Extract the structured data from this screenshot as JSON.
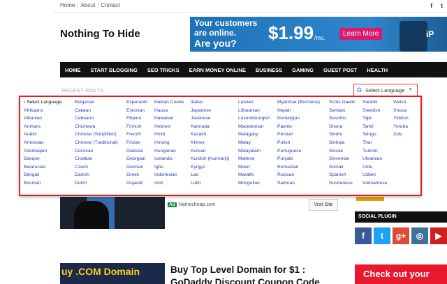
{
  "topbar": {
    "links": [
      "Home",
      "About",
      "Contact"
    ],
    "social": [
      "f",
      "t"
    ]
  },
  "site": {
    "title": "Nothing To Hide"
  },
  "banner_ad": {
    "line1": "Your customers",
    "line2": "are online.",
    "line3": "Are you?",
    "price": "$1.99",
    "per": "/mo.",
    "cta": "Learn More",
    "brand": "iP"
  },
  "nav": {
    "items": [
      "HOME",
      "START BLOGGING",
      "SEO TRICKS",
      "EARN MONEY ONLINE",
      "BUSINESS",
      "GAMING",
      "GUEST POST",
      "HEALTH"
    ]
  },
  "main": {
    "recent_posts_label": "RECENT POSTS"
  },
  "translate": {
    "g_logo": "G",
    "label": "Select Language",
    "arrow": "▼",
    "columns": [
      [
        "Select Language",
        "Afrikaans",
        "Albanian",
        "Amharic",
        "Arabic",
        "Armenian",
        "Azerbaijani",
        "Basque",
        "Belarusian",
        "Bengali",
        "Bosnian"
      ],
      [
        "Bulgarian",
        "Catalan",
        "Cebuano",
        "Chichewa",
        "Chinese (Simplified)",
        "Chinese (Traditional)",
        "Corsican",
        "Croatian",
        "Czech",
        "Danish",
        "Dutch"
      ],
      [
        "Esperanto",
        "Estonian",
        "Filipino",
        "Finnish",
        "French",
        "Frisian",
        "Galician",
        "Georgian",
        "German",
        "Greek",
        "Gujarati"
      ],
      [
        "Haitian Creole",
        "Hausa",
        "Hawaiian",
        "Hebrew",
        "Hindi",
        "Hmong",
        "Hungarian",
        "Icelandic",
        "Igbo",
        "Indonesian",
        "Irish"
      ],
      [
        "Italian",
        "Japanese",
        "Javanese",
        "Kannada",
        "Kazakh",
        "Khmer",
        "Korean",
        "Kurdish (Kurmanji)",
        "Kyrgyz",
        "Lao",
        "Latin"
      ],
      [
        "Latvian",
        "Lithuanian",
        "Luxembourgish",
        "Macedonian",
        "Malagasy",
        "Malay",
        "Malayalam",
        "Maltese",
        "Maori",
        "Marathi",
        "Mongolian"
      ],
      [
        "Myanmar (Burmese)",
        "Nepali",
        "Norwegian",
        "Pashto",
        "Persian",
        "Polish",
        "Portuguese",
        "Punjabi",
        "Romanian",
        "Russian",
        "Samoan"
      ],
      [
        "Scots Gaelic",
        "Serbian",
        "Sesotho",
        "Shona",
        "Sindhi",
        "Sinhala",
        "Slovak",
        "Slovenian",
        "Somali",
        "Spanish",
        "Sundanese"
      ],
      [
        "Swahili",
        "Swedish",
        "Tajik",
        "Tamil",
        "Telugu",
        "Thai",
        "Turkish",
        "Ukrainian",
        "Urdu",
        "Uzbek",
        "Vietnamese"
      ],
      [
        "Welsh",
        "Xhosa",
        "Yiddish",
        "Yoruba",
        "Zulu"
      ]
    ]
  },
  "ad_row": {
    "badge": "Ad",
    "url": "Namecheap.com",
    "visit": "Visit Site"
  },
  "sidebar": {
    "social_heading": "SOCIAL PLUGIN",
    "icons": [
      {
        "glyph": "f",
        "color": "#3b5998"
      },
      {
        "glyph": "t",
        "color": "#1da1f2"
      },
      {
        "glyph": "g+",
        "color": "#dd4b39"
      },
      {
        "glyph": "◎",
        "color": "#3f729b"
      },
      {
        "glyph": "▶",
        "color": "#cd201f"
      }
    ],
    "checkout_ad": "Check out your"
  },
  "post2": {
    "thumb_text": "uy .COM Domain",
    "title": "Buy Top Level Domain for $1 : GoDaddy Discount Coupon Code"
  }
}
